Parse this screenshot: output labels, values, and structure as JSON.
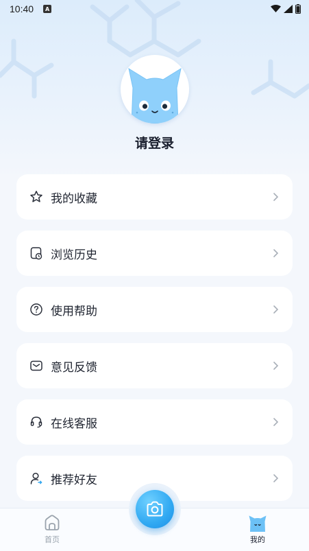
{
  "status_bar": {
    "time": "10:40",
    "notification_icon": "a-notification-icon",
    "icons": [
      "wifi-icon",
      "cellular-icon",
      "battery-icon"
    ]
  },
  "profile": {
    "avatar": "cat-avatar",
    "login_label": "请登录"
  },
  "menu": [
    {
      "label": "我的收藏",
      "icon": "star-icon"
    },
    {
      "label": "浏览历史",
      "icon": "history-icon"
    },
    {
      "label": "使用帮助",
      "icon": "help-icon"
    },
    {
      "label": "意见反馈",
      "icon": "mail-icon"
    },
    {
      "label": "在线客服",
      "icon": "headset-icon"
    },
    {
      "label": "推荐好友",
      "icon": "user-share-icon"
    }
  ],
  "tabbar": {
    "home_label": "首页",
    "mine_label": "我的",
    "camera": "camera-icon",
    "active_tab": "我的"
  },
  "colors": {
    "accent": "#31a9f2",
    "background": "#f4f7fc",
    "card": "#ffffff",
    "text": "#1f2430"
  }
}
